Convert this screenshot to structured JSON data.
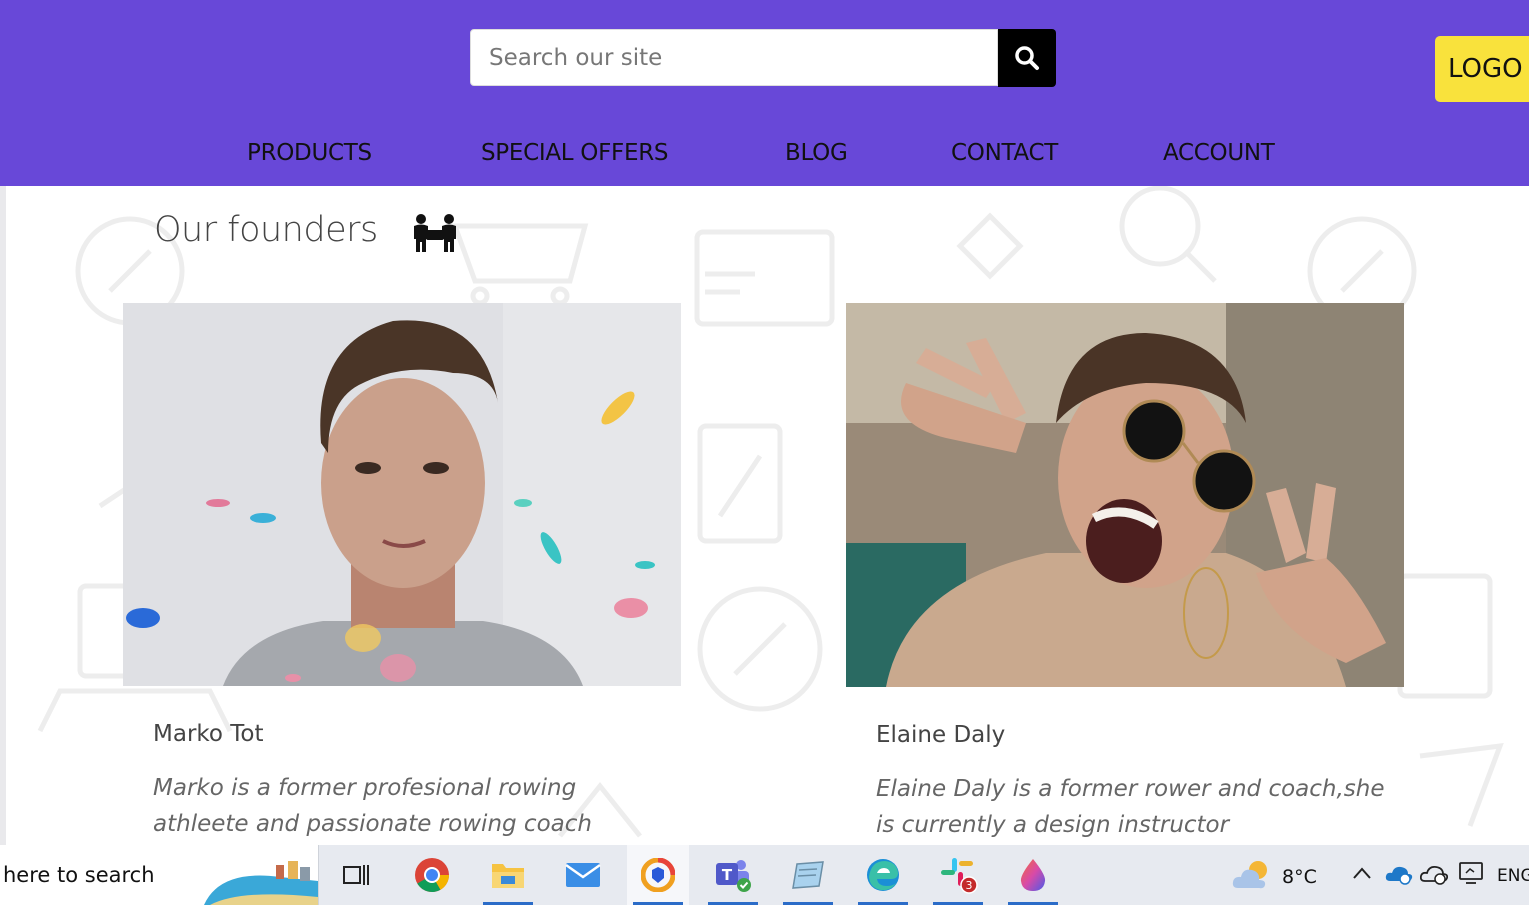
{
  "header": {
    "search_placeholder": "Search our site",
    "logo": "LOGO",
    "nav": [
      {
        "label": "PRODUCTS"
      },
      {
        "label": "SPECIAL OFFERS"
      },
      {
        "label": "BLOG"
      },
      {
        "label": "CONTACT"
      },
      {
        "label": "ACCOUNT"
      }
    ]
  },
  "founders": {
    "title": "Our founders",
    "people": [
      {
        "name": "Marko Tot",
        "bio": "Marko is a former profesional rowing athleete and passionate rowing coach"
      },
      {
        "name": "Elaine Daly",
        "bio": "Elaine Daly is a former rower and coach,she is currently a design instructor"
      }
    ]
  },
  "taskbar": {
    "search_text": "here to search",
    "apps": [
      "task-view",
      "chrome",
      "file-explorer",
      "mail",
      "browser",
      "teams",
      "notepad",
      "edge",
      "slack",
      "paint"
    ],
    "slack_badge": "3",
    "weather_temp": "8°C",
    "language": "ENG"
  },
  "colors": {
    "header_bg": "#6848d8",
    "logo_bg": "#f9e23c",
    "accent": "#2b6cc8"
  }
}
